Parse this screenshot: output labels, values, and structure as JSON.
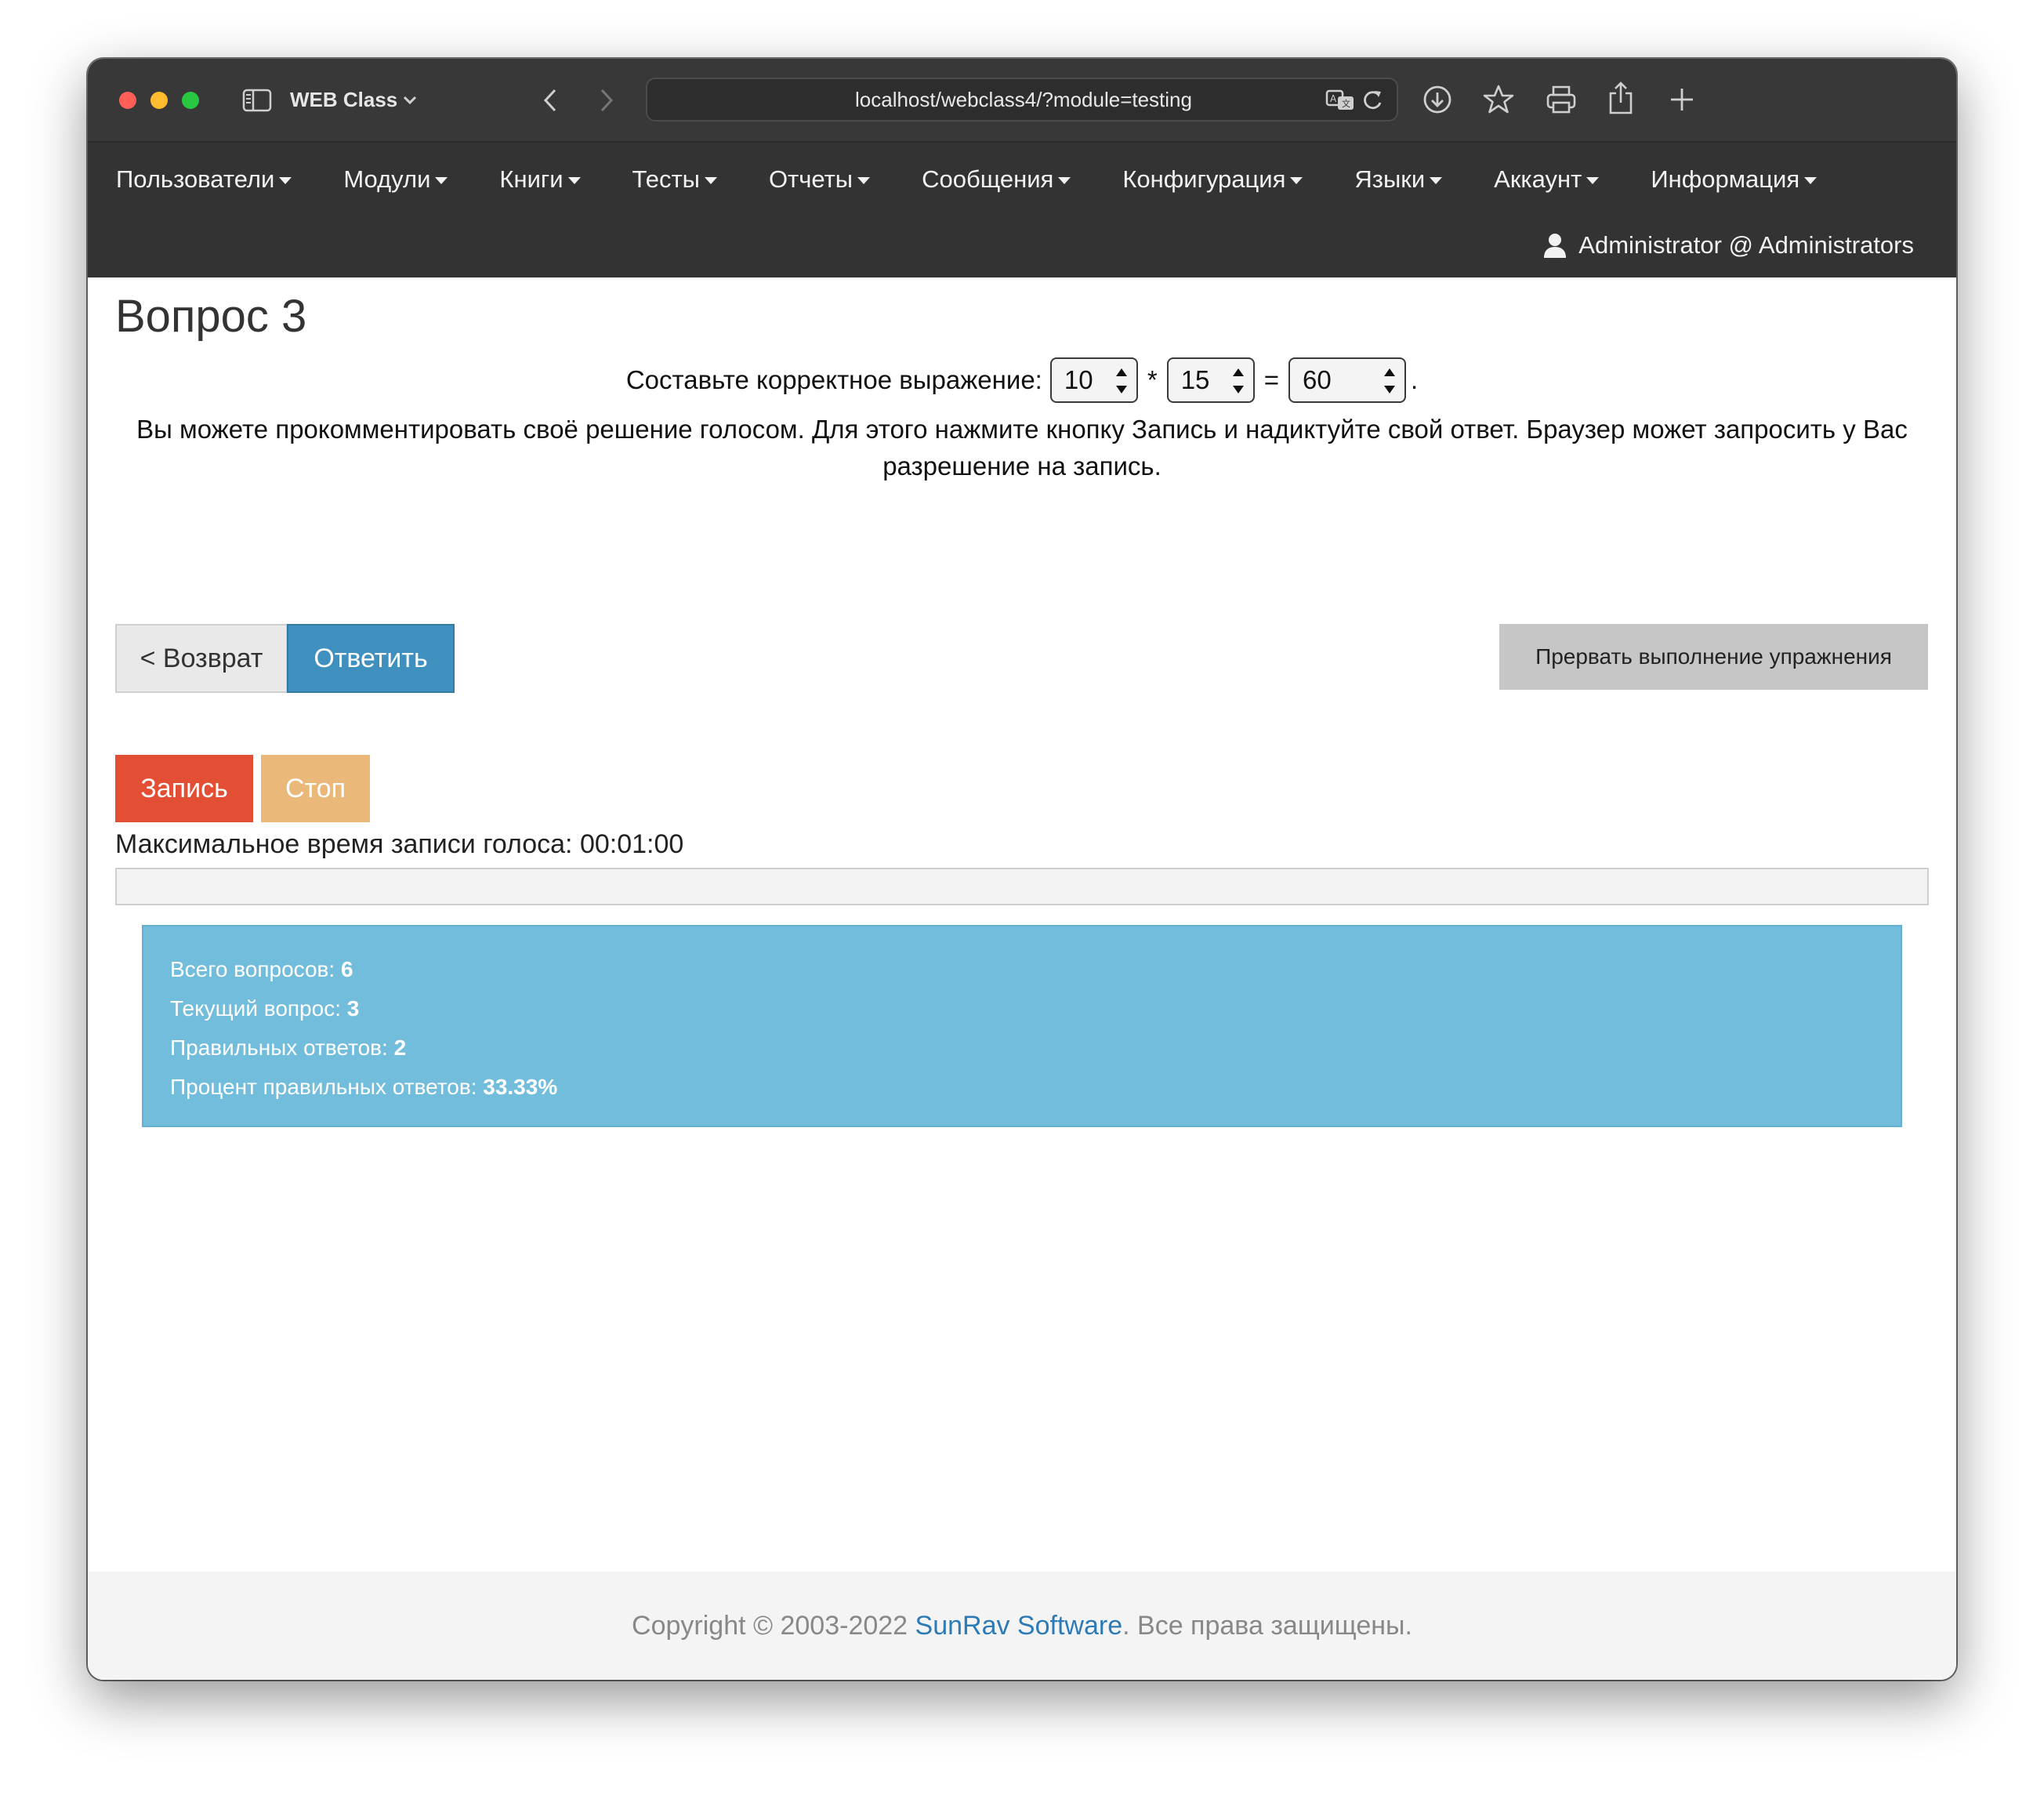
{
  "browser": {
    "app_title": "WEB Class",
    "url": "localhost/webclass4/?module=testing"
  },
  "nav": {
    "items": [
      {
        "label": "Пользователи"
      },
      {
        "label": "Модули"
      },
      {
        "label": "Книги"
      },
      {
        "label": "Тесты"
      },
      {
        "label": "Отчеты"
      },
      {
        "label": "Сообщения"
      },
      {
        "label": "Конфигурация"
      },
      {
        "label": "Языки"
      },
      {
        "label": "Аккаунт"
      },
      {
        "label": "Информация"
      }
    ],
    "user": "Administrator @ Administrators"
  },
  "question": {
    "title": "Вопрос 3",
    "prompt": "Составьте корректное выражение:",
    "select1": "10",
    "op1": "*",
    "select2": "15",
    "op2": "=",
    "select3": "60",
    "end": ".",
    "comment": "Вы можете прокомментировать своё решение голосом. Для этого нажмите кнопку Запись и надиктуйте свой ответ. Браузер может запросить у Вас разрешение на запись."
  },
  "buttons": {
    "back": "< Возврат",
    "answer": "Ответить",
    "abort": "Прервать выполнение упражнения",
    "record": "Запись",
    "stop": "Стоп"
  },
  "recording": {
    "max_time_label": "Максимальное время записи голоса: 00:01:00",
    "progress": 0
  },
  "stats": {
    "total_label": "Всего вопросов:",
    "total": "6",
    "current_label": "Текущий вопрос:",
    "current": "3",
    "correct_label": "Правильных ответов:",
    "correct": "2",
    "percent_label": "Процент правильных ответов:",
    "percent": "33.33%"
  },
  "footer": {
    "prefix": "Copyright © 2003-2022 ",
    "link": "SunRav Software",
    "suffix": ". Все права защищены."
  },
  "colors": {
    "navbar": "#333333",
    "primary": "#3f8fbf",
    "record": "#e34f34",
    "stop": "#eab97a",
    "info": "#73bddc"
  }
}
